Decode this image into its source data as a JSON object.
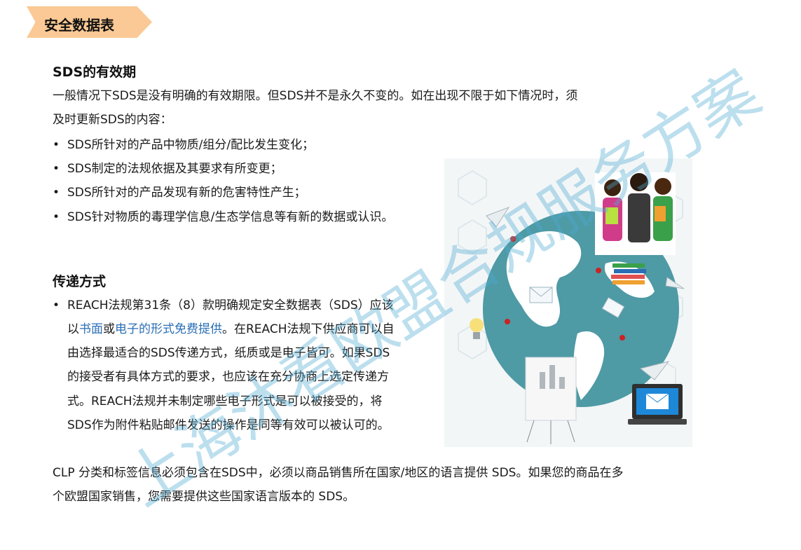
{
  "tag": {
    "label": "安全数据表"
  },
  "section1": {
    "title": "SDS的有效期",
    "intro_line1": "一般情况下SDS是没有明确的有效期限。但SDS并不是永久不变的。如在出现不限于如下情况时，须",
    "intro_line2": "及时更新SDS的内容：",
    "bullets": [
      "SDS所针对的产品中物质/组分/配比发生变化；",
      "SDS制定的法规依据及其要求有所变更；",
      "SDS所针对的产品发现有新的危害特性产生；",
      "SDS针对物质的毒理学信息/生态学信息等有新的数据或认识。"
    ]
  },
  "section2": {
    "title": "传递方式",
    "bullet_line1": "REACH法规第31条（8）款明确规定安全数据表（SDS）应该",
    "line2_pre": "以",
    "line2_link1": "书面",
    "line2_mid": "或",
    "line2_link2": "电子的形式免费提供",
    "line2_post": "。在REACH法规下供应商可以自",
    "line3": "由选择最适合的SDS传递方式，纸质或是电子皆可。如果SDS",
    "line4": "的接受者有具体方式的要求，也应该在充分协商上选定传递方",
    "line5": "式。REACH法规并未制定哪些电子形式是可以被接受的，将",
    "line6": "SDS作为附件粘贴邮件发送的操作是同等有效可以被认可的。"
  },
  "footer": {
    "line1": "CLP 分类和标签信息必须包含在SDS中，必须以商品销售所在国家/地区的语言提供  SDS。如果您的商品在多",
    "line2": "个欧盟国家销售，您需要提供这些国家语言版本的  SDS。"
  },
  "watermark": {
    "text": "上海沐看欧盟合规服务方案"
  },
  "colors": {
    "tag_bg": "#fbc995",
    "link": "#2a6eb4",
    "globe": "#4e9aa5",
    "watermark": "#50aad2"
  }
}
